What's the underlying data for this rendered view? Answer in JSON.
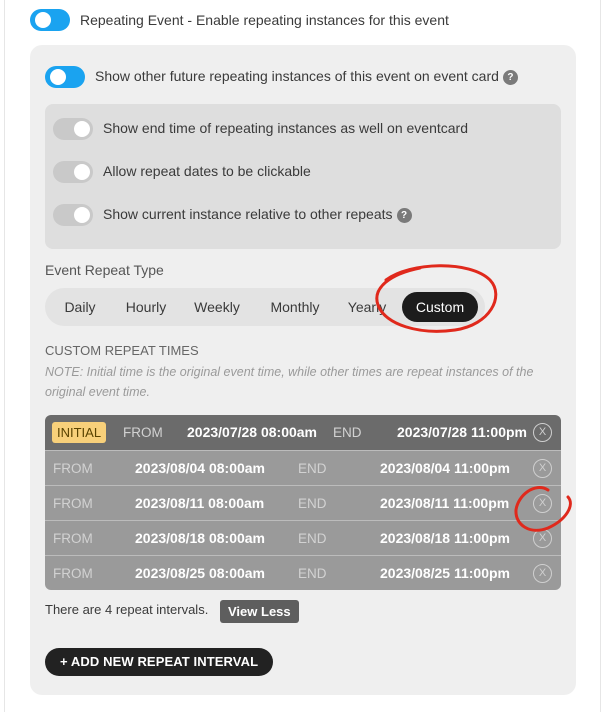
{
  "main_toggle": {
    "label": "Repeating Event - Enable repeating instances for this event",
    "state": "on"
  },
  "show_future_toggle": {
    "label": "Show other future repeating instances of this event on event card",
    "help": "?",
    "state": "on"
  },
  "sub_options": [
    {
      "label": "Show end time of repeating instances as well on eventcard",
      "state": "off"
    },
    {
      "label": "Allow repeat dates to be clickable",
      "state": "off"
    },
    {
      "label": "Show current instance relative to other repeats",
      "help": "?",
      "state": "off"
    }
  ],
  "repeat_type": {
    "heading": "Event Repeat Type",
    "options": [
      "Daily",
      "Hourly",
      "Weekly",
      "Monthly",
      "Yearly",
      "Custom"
    ],
    "selected": "Custom"
  },
  "custom_times": {
    "heading": "CUSTOM REPEAT TIMES",
    "note": "NOTE: Initial time is the original event time, while other times are repeat instances of the original event time.",
    "initial": {
      "badge": "INITIAL",
      "from_label": "FROM",
      "from": "2023/07/28 08:00am",
      "end_label": "END",
      "end": "2023/07/28 11:00pm",
      "remove": "X"
    },
    "rows": [
      {
        "from_label": "FROM",
        "from": "2023/08/04 08:00am",
        "end_label": "END",
        "end": "2023/08/04 11:00pm",
        "remove": "X"
      },
      {
        "from_label": "FROM",
        "from": "2023/08/11 08:00am",
        "end_label": "END",
        "end": "2023/08/11 11:00pm",
        "remove": "X"
      },
      {
        "from_label": "FROM",
        "from": "2023/08/18 08:00am",
        "end_label": "END",
        "end": "2023/08/18 11:00pm",
        "remove": "X"
      },
      {
        "from_label": "FROM",
        "from": "2023/08/25 08:00am",
        "end_label": "END",
        "end": "2023/08/25 11:00pm",
        "remove": "X"
      }
    ]
  },
  "intervals_text": "There are 4 repeat intervals.",
  "view_less_label": "View Less",
  "add_interval_label": "+ ADD NEW REPEAT INTERVAL",
  "colors": {
    "toggle_on": "#1aa3f0",
    "annotation": "#e0291c",
    "active_tab": "#1c1c1c"
  }
}
